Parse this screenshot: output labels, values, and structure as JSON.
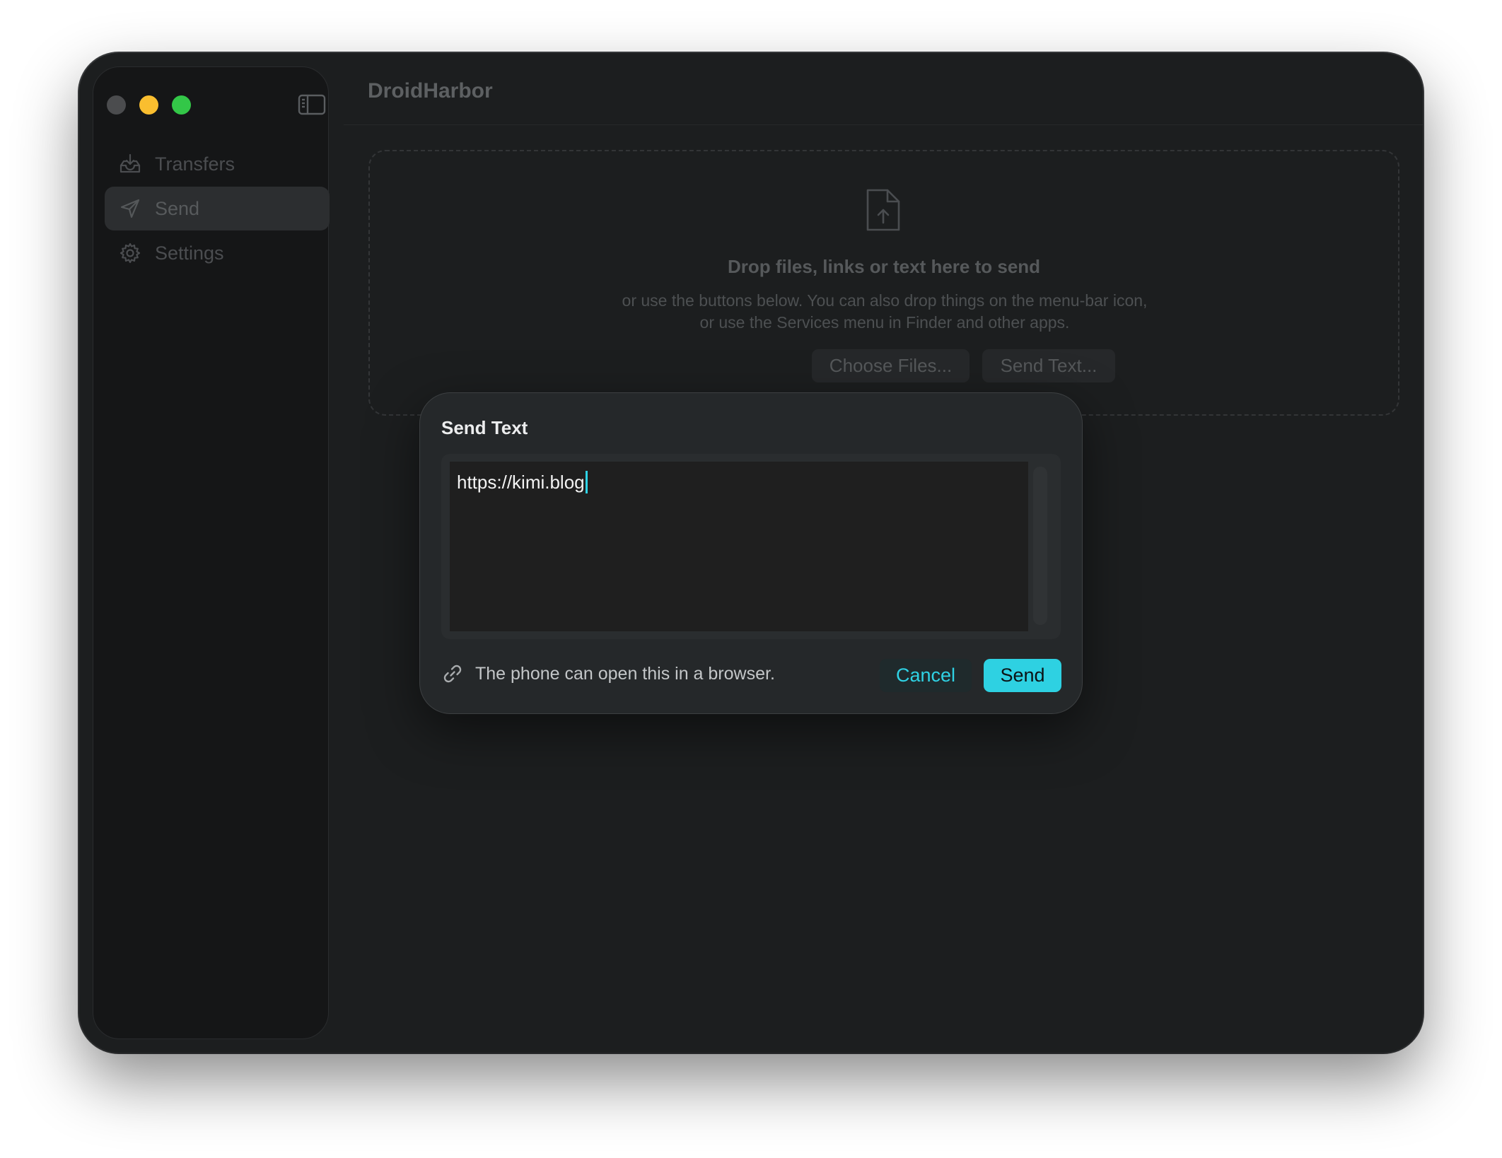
{
  "window": {
    "title": "DroidHarbor"
  },
  "sidebar": {
    "items": [
      {
        "label": "Transfers",
        "icon": "tray-download-icon",
        "active": false
      },
      {
        "label": "Send",
        "icon": "paper-plane-icon",
        "active": true
      },
      {
        "label": "Settings",
        "icon": "gear-icon",
        "active": false
      }
    ]
  },
  "dropzone": {
    "title": "Drop files, links or text here to send",
    "subtitle": "or use the buttons below. You can also drop things on the menu-bar icon, or use the Services menu in Finder and other apps.",
    "choose_files_label": "Choose Files...",
    "send_text_label": "Send Text..."
  },
  "dialog": {
    "title": "Send Text",
    "text_value": "https://kimi.blog",
    "hint": "The phone can open this in a browser.",
    "cancel_label": "Cancel",
    "send_label": "Send"
  },
  "colors": {
    "accent": "#2ed1e2",
    "traffic_min": "#fabe2f",
    "traffic_max": "#33c748"
  }
}
